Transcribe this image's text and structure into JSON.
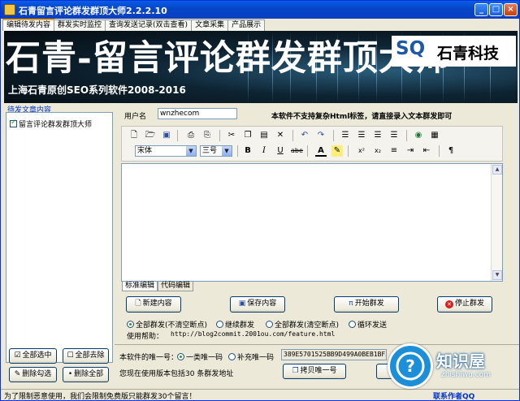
{
  "window": {
    "title": "石青留言评论群发群顶大师2.2.2.10"
  },
  "tabs": [
    "编辑待发内容",
    "群发实时监控",
    "查询发送记录(双击查看)",
    "文章采集",
    "产品展示"
  ],
  "banner": {
    "headline": "石青-留言评论群发群顶大师",
    "subtitle": "上海石青原创SEO系列软件2008-2016",
    "logo_sq": "SQ",
    "logo_text": "石青科技"
  },
  "left": {
    "caption": "待发文章内容",
    "items": [
      "留言评论群发群顶大师"
    ],
    "buttons": {
      "select_all": "全部选中",
      "remove_all": "全部去除",
      "delete_checked": "删除勾选",
      "delete_all": "删除全部"
    }
  },
  "form": {
    "username_label": "用户名",
    "username_value": "wnzhecom",
    "notice": "本软件不支持复杂Html标签，请直接录入文本群发即可"
  },
  "toolbar": {
    "font": "宋体",
    "size": "三号"
  },
  "editor": {
    "tabs": [
      "标准编辑",
      "代码编辑"
    ]
  },
  "actions": {
    "new": "新建内容",
    "save": "保存内容",
    "start": "开始群发",
    "stop": "停止群发"
  },
  "modes": {
    "opt1": "全部群发(不清空断点)",
    "opt2": "继续群发",
    "opt3": "全部群发(清空断点)",
    "opt4": "循环发送",
    "selected": "opt1"
  },
  "help": {
    "label": "使用帮助：",
    "url": "http://blog2commit.2001ou.com/feature.html"
  },
  "id": {
    "label": "本软件的唯一号：",
    "opt1": "一类唯一码",
    "opt2": "补充唯一码",
    "value": "389E5701525BB9D499A0BEB1BF34",
    "copy": "拷贝唯一号"
  },
  "version_note": "您现在使用版本包括30 条群发地址",
  "contact": "联系作者QQ",
  "status": "为了限制恶意使用，我们会限制免费版只能群发30个留言！",
  "watermark": {
    "text": "知识屋",
    "url": "zhishiwu.com"
  },
  "colors": {
    "titlebar": "#0a5ee8",
    "caption": "#0033cc"
  }
}
